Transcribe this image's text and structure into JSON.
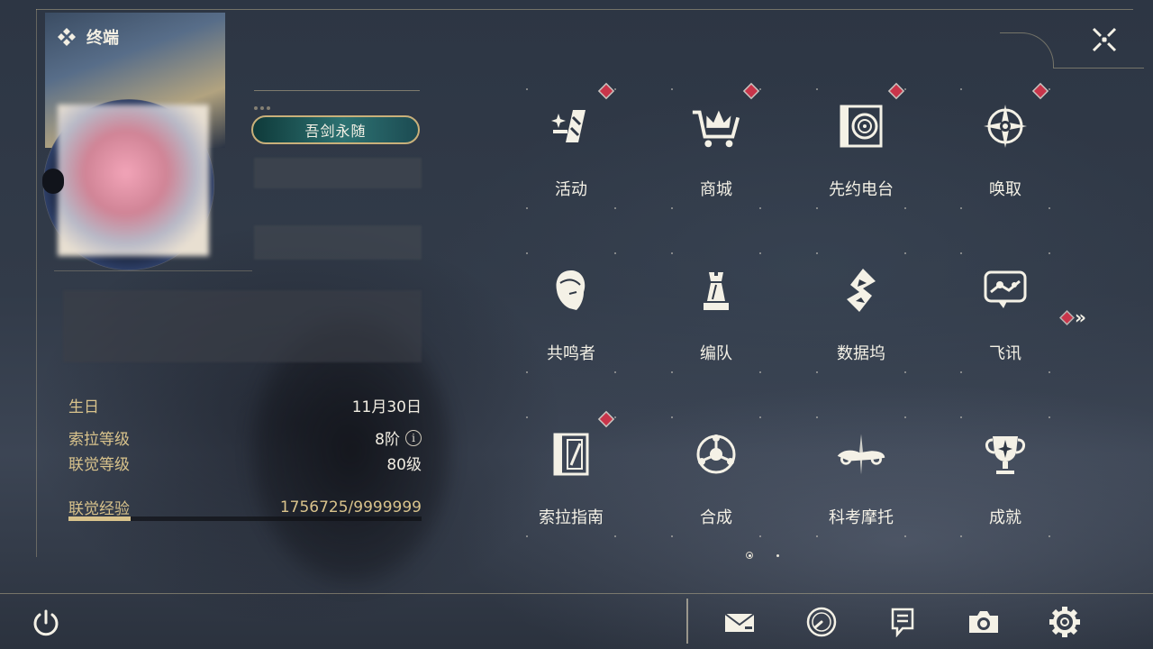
{
  "window": {
    "title": "终端"
  },
  "profile": {
    "title_badge": "吾剑永随",
    "birthday_label": "生日",
    "birthday_value": "11月30日",
    "sola_level_label": "索拉等级",
    "sola_level_value": "8阶",
    "union_level_label": "联觉等级",
    "union_level_value": "80级",
    "union_exp_label": "联觉经验",
    "union_exp_value": "1756725/9999999",
    "union_exp_progress": 0.1757,
    "info_icon_glyph": "i"
  },
  "menu": {
    "items": [
      {
        "label": "活动",
        "icon": "activity-icon",
        "badge": true
      },
      {
        "label": "商城",
        "icon": "shop-cart-icon",
        "badge": true
      },
      {
        "label": "先约电台",
        "icon": "radio-icon",
        "badge": true
      },
      {
        "label": "唤取",
        "icon": "summon-compass-icon",
        "badge": true
      },
      {
        "label": "共鸣者",
        "icon": "resonator-icon",
        "badge": false
      },
      {
        "label": "编队",
        "icon": "team-chess-icon",
        "badge": false
      },
      {
        "label": "数据坞",
        "icon": "data-dock-icon",
        "badge": false
      },
      {
        "label": "飞讯",
        "icon": "message-icon",
        "badge": false
      },
      {
        "label": "索拉指南",
        "icon": "guide-icon",
        "badge": true
      },
      {
        "label": "合成",
        "icon": "synthesis-icon",
        "badge": false
      },
      {
        "label": "科考摩托",
        "icon": "motorcycle-icon",
        "badge": false
      },
      {
        "label": "成就",
        "icon": "trophy-icon",
        "badge": false
      }
    ],
    "next_page": "»"
  },
  "colors": {
    "accent_gold": "#d9c38c",
    "badge_red": "#c8354a",
    "title_teal": "#2d7272"
  },
  "bottom_bar": {
    "icons": [
      "power-icon",
      "mail-icon",
      "clock-icon",
      "notice-icon",
      "camera-icon",
      "settings-gear-icon"
    ]
  }
}
